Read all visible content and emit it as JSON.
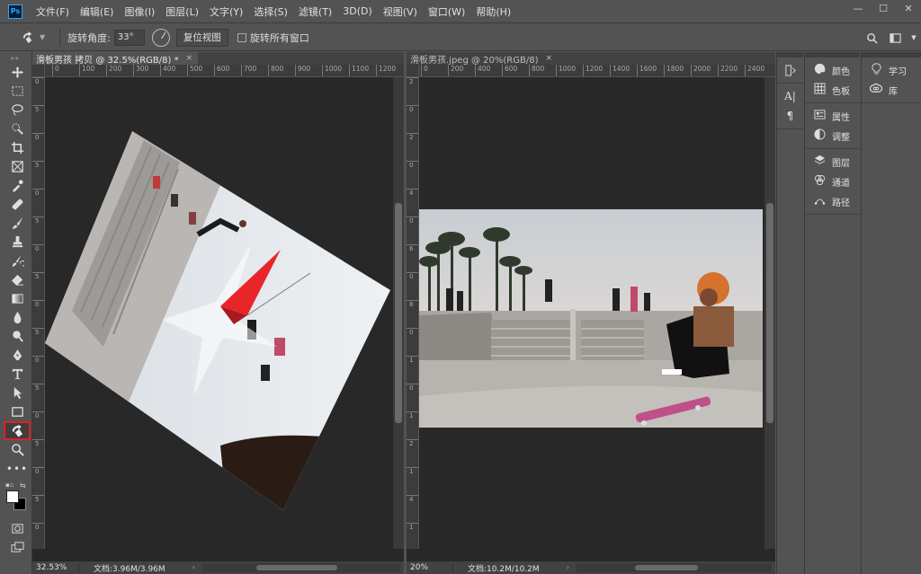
{
  "app": {
    "logo": "Ps"
  },
  "menu": [
    "文件(F)",
    "编辑(E)",
    "图像(I)",
    "图层(L)",
    "文字(Y)",
    "选择(S)",
    "滤镜(T)",
    "3D(D)",
    "视图(V)",
    "窗口(W)",
    "帮助(H)"
  ],
  "window_controls": {
    "minimize": "—",
    "maximize": "☐",
    "close": "✕"
  },
  "options": {
    "angle_label": "旋转角度:",
    "angle_value": "33°",
    "reset_view": "复位视图",
    "rotate_all": "旋转所有窗口"
  },
  "toolbar": {
    "tools": [
      "move-tool",
      "marquee-tool",
      "lasso-tool",
      "quick-select-tool",
      "crop-tool",
      "frame-tool",
      "eyedropper-tool",
      "healing-tool",
      "brush-tool",
      "clone-stamp-tool",
      "history-brush-tool",
      "eraser-tool",
      "gradient-tool",
      "blur-tool",
      "dodge-tool",
      "pen-tool",
      "type-tool",
      "path-select-tool",
      "rectangle-tool",
      "rotate-view-tool",
      "zoom-tool",
      "more-tools"
    ],
    "active_tool": "rotate-view-tool",
    "foreground_color": "#ffffff",
    "background_color": "#000000"
  },
  "doc1": {
    "tab_title": "滑板男孩 拷贝 @ 32.5%(RGB/8) *",
    "close": "×",
    "ruler_h": [
      "0",
      "100",
      "200",
      "300",
      "400",
      "500",
      "600",
      "700",
      "800",
      "900",
      "1000",
      "1100",
      "1200"
    ],
    "ruler_v": [
      "0",
      "5",
      "0",
      "5",
      "0",
      "5",
      "0",
      "5",
      "0",
      "5",
      "0",
      "5",
      "0",
      "5",
      "0",
      "5",
      "0"
    ],
    "zoom": "32.53%",
    "doc_size": "文档:3.96M/3.96M"
  },
  "doc2": {
    "tab_title": "滑板男孩.jpeg @ 20%(RGB/8)",
    "close": "×",
    "ruler_h": [
      "0",
      "200",
      "400",
      "600",
      "800",
      "1000",
      "1200",
      "1400",
      "1600",
      "1800",
      "2000",
      "2200",
      "2400"
    ],
    "ruler_v": [
      "2",
      "0",
      "2",
      "0",
      "4",
      "0",
      "6",
      "0",
      "8",
      "0",
      "1",
      "0",
      "1",
      "2",
      "1",
      "4",
      "1"
    ],
    "zoom": "20%",
    "doc_size": "文档:10.2M/10.2M"
  },
  "panels": {
    "col1": [
      "history-icon",
      "character-icon",
      "paragraph-icon"
    ],
    "col2_groups": [
      [
        {
          "icon": "palette-icon",
          "label": "颜色"
        },
        {
          "icon": "grid-icon",
          "label": "色板"
        }
      ],
      [
        {
          "icon": "properties-icon",
          "label": "属性"
        },
        {
          "icon": "adjust-icon",
          "label": "调整"
        }
      ],
      [
        {
          "icon": "layers-icon",
          "label": "图层"
        },
        {
          "icon": "channels-icon",
          "label": "通道"
        },
        {
          "icon": "paths-icon",
          "label": "路径"
        }
      ]
    ],
    "col3": [
      {
        "icon": "bulb-icon",
        "label": "学习"
      },
      {
        "icon": "cc-icon",
        "label": "库"
      }
    ]
  }
}
